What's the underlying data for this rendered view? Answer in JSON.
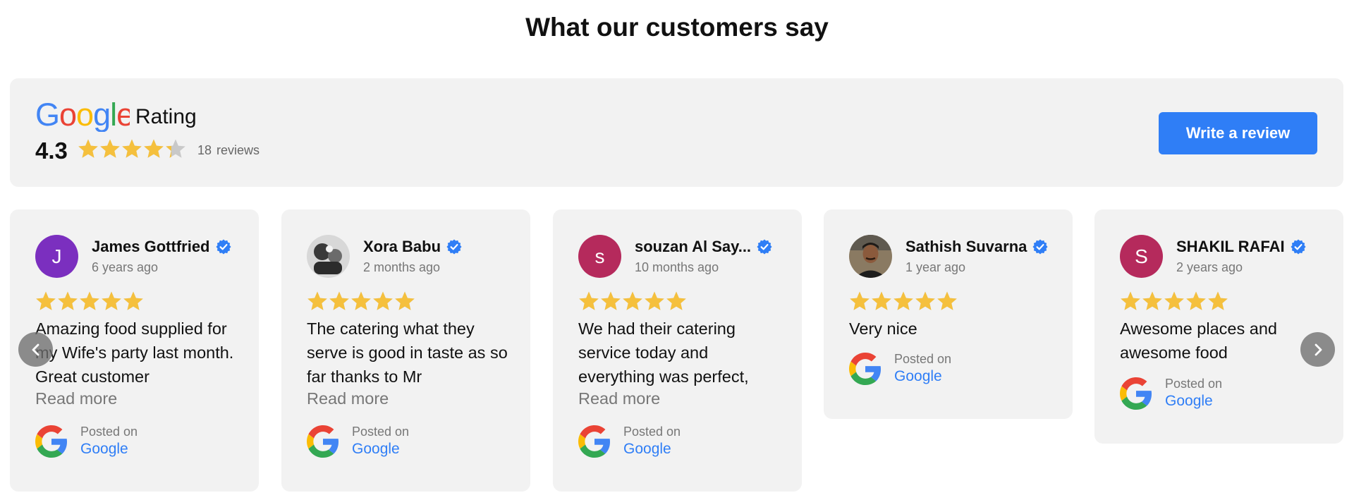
{
  "title": "What our customers say",
  "summary": {
    "brand": "Google",
    "rating_label": "Rating",
    "score": "4.3",
    "stars": 4.3,
    "count": "18",
    "count_label": "reviews",
    "button": "Write a review"
  },
  "reviews": [
    {
      "name": "James Gottfried",
      "initial": "J",
      "avatar_color": "#7b2fbf",
      "time": "6 years ago",
      "stars": 5,
      "text": "Amazing food supplied for my Wife's party last month. Great customer",
      "read_more": "Read more",
      "posted_on": "Posted on",
      "source": "Google"
    },
    {
      "name": "Xora Babu",
      "initial": "",
      "avatar_icon": "photo-avatar",
      "time": "2 months ago",
      "stars": 5,
      "text": "The catering what they serve is good in taste as so far thanks to Mr",
      "read_more": "Read more",
      "posted_on": "Posted on",
      "source": "Google"
    },
    {
      "name": "souzan Al Say...",
      "initial": "s",
      "avatar_color": "#b52a5c",
      "time": "10 months ago",
      "stars": 5,
      "text": "We had their catering service today and everything was perfect,",
      "read_more": "Read more",
      "posted_on": "Posted on",
      "source": "Google"
    },
    {
      "name": "Sathish Suvarna",
      "initial": "",
      "avatar_icon": "photo-avatar",
      "time": "1 year ago",
      "stars": 5,
      "text": "Very nice",
      "posted_on": "Posted on",
      "source": "Google"
    },
    {
      "name": "SHAKIL RAFAI",
      "initial": "S",
      "avatar_color": "#b52a5c",
      "time": "2 years ago",
      "stars": 5,
      "text": "Awesome places and awesome food",
      "posted_on": "Posted on",
      "source": "Google"
    }
  ],
  "colors": {
    "star": "#f5c03d",
    "star_empty": "#c9c9c9",
    "accent": "#2f7ef6",
    "verified": "#2f7ef6"
  },
  "icons": {
    "prev": "chevron-left-icon",
    "next": "chevron-right-icon",
    "verified": "verified-badge-icon",
    "source": "google-g-icon"
  }
}
